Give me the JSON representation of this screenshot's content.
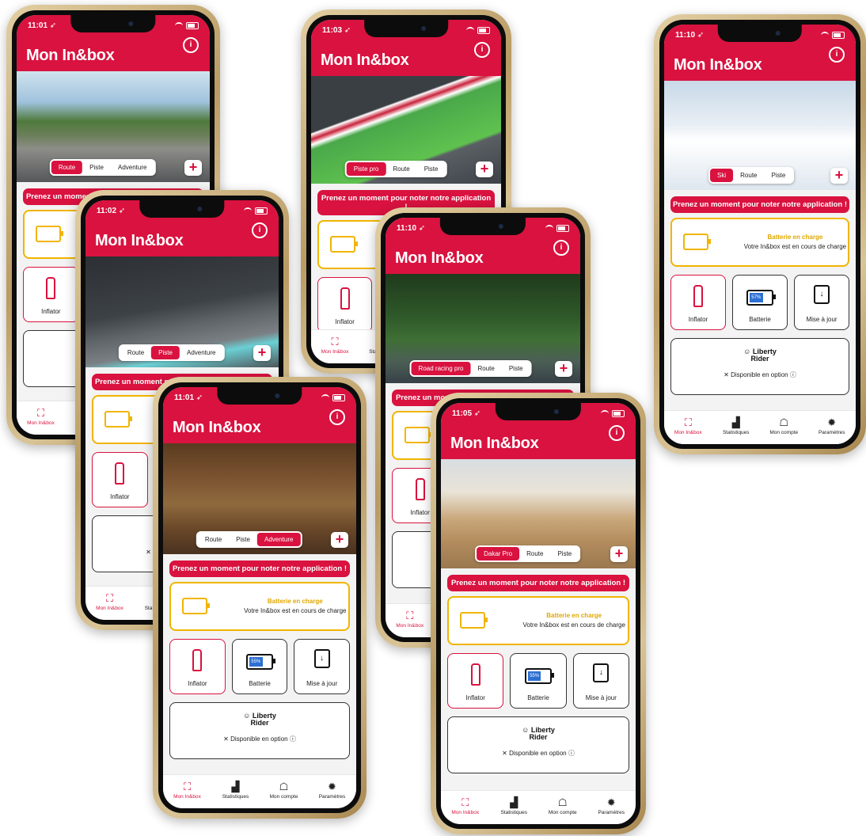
{
  "app_title": "Mon In&box",
  "rate_banner": "Prenez un moment pour noter notre application !",
  "charging": {
    "title": "Batterie en charge",
    "subtitle": "Votre In&box est en cours de charge"
  },
  "tiles": {
    "inflator": "Inflator",
    "battery": "Batterie",
    "update": "Mise à jour"
  },
  "liberty": {
    "brand_line1": "Liberty",
    "brand_line2": "Rider",
    "option_text": "Disponible en option",
    "close_glyph": "✕",
    "info_glyph": "ⓘ"
  },
  "tabbar": {
    "home": "Mon In&box",
    "stats": "Statistiques",
    "account": "Mon compte",
    "settings": "Paramètres"
  },
  "plus_label": "+",
  "info_icon_glyph": "i",
  "update_glyph": "↓",
  "colors": {
    "brand_red": "#d9123f",
    "charge_yellow": "#f0b500",
    "battery_blue": "#2d6fd2"
  },
  "phones": [
    {
      "time": "11:01",
      "segments": [
        "Route",
        "Piste",
        "Adventure"
      ],
      "active": 0,
      "scene": "road"
    },
    {
      "time": "11:03",
      "segments": [
        "Piste pro",
        "Route",
        "Piste"
      ],
      "active": 0,
      "scene": "circuit"
    },
    {
      "time": "11:10",
      "segments": [
        "Ski",
        "Route",
        "Piste"
      ],
      "active": 0,
      "scene": "ski",
      "battery_level": "57%"
    },
    {
      "time": "11:02",
      "segments": [
        "Route",
        "Piste",
        "Adventure"
      ],
      "active": 1,
      "scene": "track"
    },
    {
      "time": "11:10",
      "segments": [
        "Road racing pro",
        "Route",
        "Piste"
      ],
      "active": 0,
      "scene": "roadracing"
    },
    {
      "time": "11:01",
      "segments": [
        "Route",
        "Piste",
        "Adventure"
      ],
      "active": 2,
      "scene": "forest",
      "battery_level": "55%"
    },
    {
      "time": "11:05",
      "segments": [
        "Dakar Pro",
        "Route",
        "Piste"
      ],
      "active": 0,
      "scene": "desert",
      "battery_level": "55%"
    }
  ]
}
